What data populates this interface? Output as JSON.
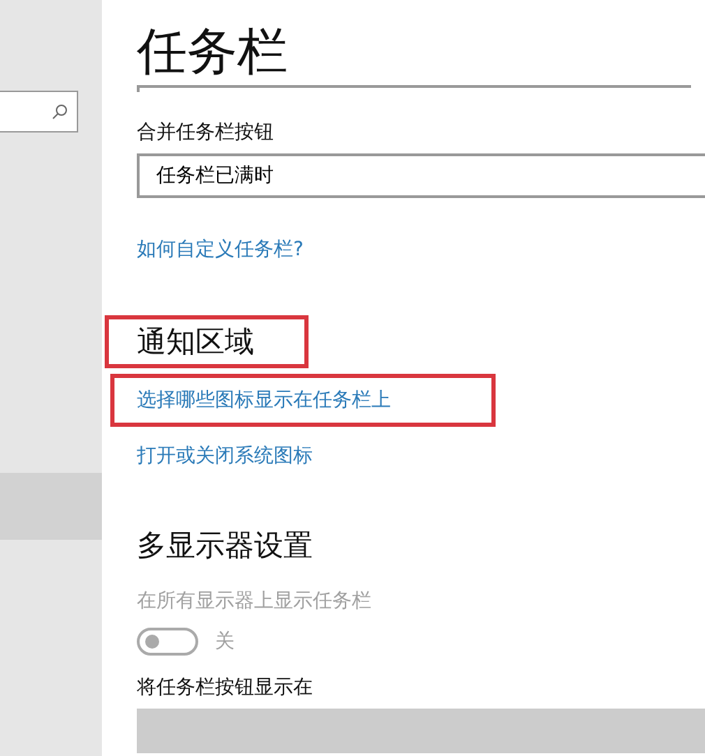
{
  "sidebar": {
    "items": [
      {
        "selected": true
      }
    ]
  },
  "page": {
    "title": "任务栏"
  },
  "sections": [
    {
      "kind": "dropdown",
      "label": "合并任务栏按钮",
      "value": "任务栏已满时",
      "disabled": false
    },
    {
      "kind": "link",
      "text": "如何自定义任务栏?",
      "highlighted": false
    },
    {
      "kind": "heading",
      "text": "通知区域",
      "highlighted": true
    },
    {
      "kind": "link",
      "text": "选择哪些图标显示在任务栏上",
      "highlighted": true
    },
    {
      "kind": "link",
      "text": "打开或关闭系统图标",
      "highlighted": false
    },
    {
      "kind": "heading",
      "text": "多显示器设置",
      "highlighted": false
    },
    {
      "kind": "toggle",
      "label": "在所有显示器上显示任务栏",
      "state_text": "关",
      "on": false,
      "disabled": true
    },
    {
      "kind": "dropdown",
      "label": "将任务栏按钮显示在",
      "disabled": true
    }
  ]
}
